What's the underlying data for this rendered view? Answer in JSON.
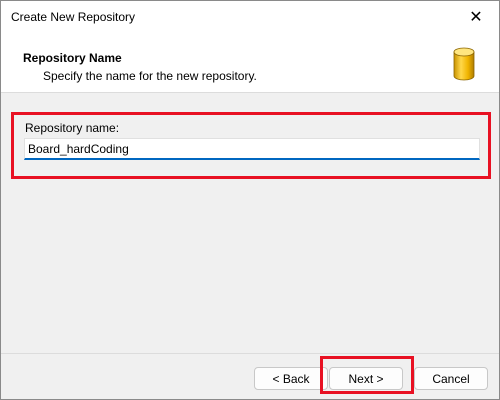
{
  "window": {
    "title": "Create New Repository",
    "close_glyph": "✕"
  },
  "header": {
    "title": "Repository Name",
    "subtitle": "Specify the name for the new repository.",
    "icon": "database-icon",
    "icon_color": "#e8b800"
  },
  "form": {
    "repository_label": "Repository name:",
    "repository_value": "Board_hardCoding"
  },
  "buttons": {
    "back_label": "< Back",
    "next_label": "Next >",
    "cancel_label": "Cancel"
  },
  "colors": {
    "highlight": "#e81123",
    "input_accent": "#0067c0"
  }
}
